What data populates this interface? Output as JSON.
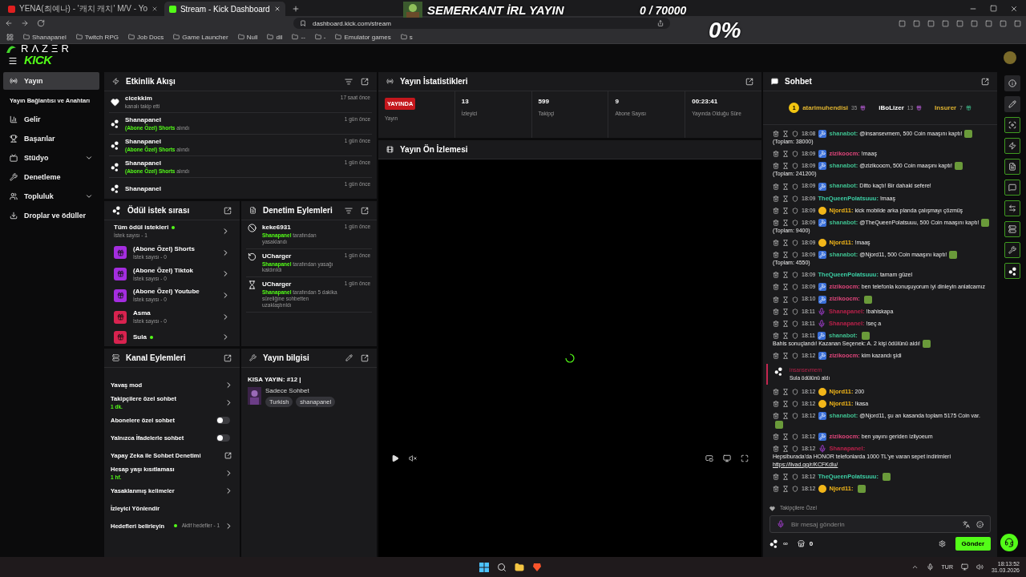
{
  "browser": {
    "tabs": [
      {
        "title": "YENA(최예나) - '캐치 캐치' M/V - Yo",
        "kind": "video",
        "selected": false
      },
      {
        "title": "Stream - Kick Dashboard",
        "kind": "kick",
        "selected": true
      }
    ],
    "url": "dashboard.kick.com/stream",
    "bookmarks": [
      "Shanapanel",
      "Twitch RPG",
      "Job Docs",
      "Game Launcher",
      "Null",
      "dil",
      "--",
      "-",
      "Emulator games",
      "s"
    ]
  },
  "overlay": {
    "title": "SEMERKANT İRL YAYIN",
    "goal": "0 / 70000",
    "percent": "0%",
    "sponsor": "RΛZΞR"
  },
  "header": {
    "logo": "KICK"
  },
  "sidebar": {
    "items": [
      {
        "label": "Yayın",
        "kind": "link",
        "selected": true
      },
      {
        "label": "Yayın Bağlantısı ve Anahtarı",
        "kind": "sub",
        "selected": false
      },
      {
        "label": "Gelir",
        "kind": "link",
        "selected": false
      },
      {
        "label": "Başarılar",
        "kind": "link",
        "selected": false
      },
      {
        "label": "Stüdyo",
        "kind": "group",
        "selected": false
      },
      {
        "label": "Denetleme",
        "kind": "link",
        "selected": false
      },
      {
        "label": "Topluluk",
        "kind": "group",
        "selected": false
      },
      {
        "label": "Droplar ve ödüller",
        "kind": "link",
        "selected": false
      }
    ]
  },
  "activity": {
    "title": "Etkinlik Akışı",
    "items": [
      {
        "kind": "follow",
        "user": "cicekkim",
        "action": "kanalı takip etti",
        "time": "17 saat önce"
      },
      {
        "kind": "redeem",
        "user": "Shanapanel",
        "reward": "(Abone Özel) Shorts",
        "action": "alındı",
        "time": "1 gün önce"
      },
      {
        "kind": "redeem",
        "user": "Shanapanel",
        "reward": "(Abone Özel) Shorts",
        "action": "alındı",
        "time": "1 gün önce"
      },
      {
        "kind": "redeem",
        "user": "Shanapanel",
        "reward": "(Abone Özel) Shorts",
        "action": "alındı",
        "time": "1 gün önce"
      },
      {
        "kind": "redeem",
        "user": "Shanapanel",
        "time": "1 gün önce"
      }
    ]
  },
  "stats": {
    "title": "Yayın İstatistikleri",
    "badge": "YAYINDA",
    "badge_label": "Yayın",
    "items": [
      {
        "value": "13",
        "label": "İzleyici"
      },
      {
        "value": "599",
        "label": "Takipçi"
      },
      {
        "value": "9",
        "label": "Abone Sayısı"
      },
      {
        "value": "00:23:41",
        "label": "Yayında Olduğu Süre"
      }
    ]
  },
  "preview": {
    "title": "Yayın Ön İzlemesi"
  },
  "rewards": {
    "title": "Ödül istek sırası",
    "items": [
      {
        "kind": "all",
        "title": "Tüm ödül istekleri",
        "subtitle": "İstek sayısı - 1",
        "active": true
      },
      {
        "kind": "reward",
        "title": "(Abone Özel) Shorts",
        "subtitle": "İstek sayısı - 0",
        "color": "#a42de0",
        "active": false
      },
      {
        "kind": "reward",
        "title": "(Abone Özel) Tiktok",
        "subtitle": "İstek sayısı - 0",
        "color": "#a42de0",
        "active": false
      },
      {
        "kind": "reward",
        "title": "(Abone Özel) Youtube",
        "subtitle": "İstek sayısı - 0",
        "color": "#a42de0",
        "active": false
      },
      {
        "kind": "reward",
        "title": "Asma",
        "subtitle": "İstek sayısı - 0",
        "color": "#d8234f",
        "active": false
      },
      {
        "kind": "reward",
        "title": "Sula",
        "color": "#d8234f",
        "active": true
      }
    ]
  },
  "moderation": {
    "title": "Denetim Eylemleri",
    "items": [
      {
        "kind": "ban",
        "user": "keke6931",
        "actor": "Shanapanel",
        "text": "tarafından yasaklandı",
        "time": "1 gün önce"
      },
      {
        "kind": "unban",
        "user": "UCharger",
        "actor": "Shanapanel",
        "text": "tarafından yasağı kaldırıldı",
        "time": "1 gün önce"
      },
      {
        "kind": "timeout",
        "user": "UCharger",
        "actor": "Shanapanel",
        "text": "tarafından 5 dakika süreliğine sohbetten uzaklaştırıldı",
        "time": "1 gün önce"
      }
    ]
  },
  "channel_actions": {
    "title": "Kanal Eylemleri",
    "items": [
      {
        "kind": "link",
        "label": "Yavaş mod"
      },
      {
        "kind": "link",
        "label": "Takipçilere özel sohbet",
        "value": "1 dk."
      },
      {
        "kind": "toggle",
        "label": "Abonelere özel sohbet",
        "on": false
      },
      {
        "kind": "toggle",
        "label": "Yalnızca İfadelerle sohbet",
        "on": false
      },
      {
        "kind": "external",
        "label": "Yapay Zeka ile Sohbet Denetimi"
      },
      {
        "kind": "link",
        "label": "Hesap yaşı kısıtlaması",
        "value": "1 hf."
      },
      {
        "kind": "link",
        "label": "Yasaklanmış kelimeler"
      },
      {
        "kind": "plain",
        "label": "İzleyici Yönlendir"
      },
      {
        "kind": "goal",
        "label": "Hedefleri belirleyin",
        "note": "Aktif hedefler - 1"
      }
    ]
  },
  "stream_info": {
    "title": "Yayın bilgisi",
    "stream_title": "KISA YAYIN: #12 |",
    "category": "Sadece Sohbet",
    "tags": [
      "Turkish",
      "shanapanel"
    ]
  },
  "chat": {
    "title": "Sohbet",
    "top": [
      {
        "name": "atarimuhendisi",
        "count": "35",
        "rank": "1"
      },
      {
        "name": "iBoLizer",
        "count": "13"
      },
      {
        "name": "Insurer",
        "count": "7"
      }
    ],
    "messages": [
      {
        "kind": "bot",
        "time": "18:08",
        "user": "shanabot:",
        "color": "#3fbf8f",
        "parts": [
          {
            "kind": "text",
            "text": "@insansevmem, 500 Coin maaşını kaptı!"
          },
          {
            "kind": "emote"
          },
          {
            "kind": "text",
            "text": "(Toplam: 38000)"
          }
        ]
      },
      {
        "kind": "bot",
        "time": "18:09",
        "user": "zizikoocm:",
        "color": "#e0457b",
        "parts": [
          {
            "kind": "text",
            "text": "!maaş"
          }
        ]
      },
      {
        "kind": "bot",
        "time": "18:09",
        "user": "shanabot:",
        "color": "#3fbf8f",
        "parts": [
          {
            "kind": "text",
            "text": "@zizikoocm, 500 Coin maaşını kaptı!"
          },
          {
            "kind": "emote"
          },
          {
            "kind": "text",
            "text": "(Toplam: 241200)"
          }
        ]
      },
      {
        "kind": "bot",
        "time": "18:09",
        "user": "shanabot:",
        "color": "#3fbf8f",
        "parts": [
          {
            "kind": "text",
            "text": "Ditto kaçtı! Bir dahaki sefere!"
          }
        ]
      },
      {
        "kind": "plain",
        "time": "18:09",
        "user": "TheQueenPolatsuuu:",
        "color": "#3ccfa5",
        "parts": [
          {
            "kind": "text",
            "text": "!maaş"
          }
        ]
      },
      {
        "kind": "coin",
        "time": "18:09",
        "user": "Njord11:",
        "color": "#f2b619",
        "parts": [
          {
            "kind": "text",
            "text": "kick mobilde arka planda çalışmayı çözmüş"
          }
        ]
      },
      {
        "kind": "bot",
        "time": "18:09",
        "user": "shanabot:",
        "color": "#3fbf8f",
        "parts": [
          {
            "kind": "text",
            "text": "@TheQueenPolatsuuu, 500 Coin maaşını kaptı!"
          },
          {
            "kind": "emote"
          },
          {
            "kind": "text",
            "text": "(Toplam: 9400)"
          }
        ]
      },
      {
        "kind": "coin",
        "time": "18:09",
        "user": "Njord11:",
        "color": "#f2b619",
        "parts": [
          {
            "kind": "text",
            "text": "!maaş"
          }
        ]
      },
      {
        "kind": "bot",
        "time": "18:09",
        "user": "shanabot:",
        "color": "#3fbf8f",
        "parts": [
          {
            "kind": "text",
            "text": "@Njord11, 500 Coin maaşını kaptı!"
          },
          {
            "kind": "emote"
          },
          {
            "kind": "text",
            "text": "(Toplam: 4550)"
          }
        ]
      },
      {
        "kind": "plain",
        "time": "18:09",
        "user": "TheQueenPolatsuuu:",
        "color": "#3ccfa5",
        "parts": [
          {
            "kind": "text",
            "text": "tamam güzel"
          }
        ]
      },
      {
        "kind": "bot",
        "time": "18:09",
        "user": "zizikoocm:",
        "color": "#e0457b",
        "parts": [
          {
            "kind": "text",
            "text": "ben telefonla konuşuyorum iyi dinleyin anlatcamız"
          }
        ]
      },
      {
        "kind": "bot",
        "time": "18:10",
        "user": "zizikoocm:",
        "color": "#e0457b",
        "parts": [
          {
            "kind": "emote"
          }
        ]
      },
      {
        "kind": "sub",
        "time": "18:11",
        "user": "Shanapanel:",
        "color": "#b8214a",
        "parts": [
          {
            "kind": "text",
            "text": "!bahiskapa"
          }
        ]
      },
      {
        "kind": "sub",
        "time": "18:11",
        "user": "Shanapanel:",
        "color": "#b8214a",
        "parts": [
          {
            "kind": "text",
            "text": "!seç a"
          }
        ]
      },
      {
        "kind": "bot",
        "time": "18:11",
        "user": "shanabot:",
        "color": "#3fbf8f",
        "parts": [
          {
            "kind": "emote"
          },
          {
            "kind": "text",
            "text": "Bahis sonuçlandı! Kazanan Seçenek: A. 2 kişi ödülünü aldı!"
          },
          {
            "kind": "emote"
          }
        ]
      },
      {
        "kind": "bot",
        "time": "18:12",
        "user": "zizikoocm:",
        "color": "#e0457b",
        "parts": [
          {
            "kind": "text",
            "text": "kim kazandı şidi"
          }
        ]
      },
      {
        "kind": "reward",
        "user": "insansevmem",
        "text": "Sula ödülünü aldı"
      },
      {
        "kind": "coin",
        "time": "18:12",
        "user": "Njord11:",
        "color": "#f2b619",
        "parts": [
          {
            "kind": "text",
            "text": "200"
          }
        ]
      },
      {
        "kind": "coin",
        "time": "18:12",
        "user": "Njord11:",
        "color": "#f2b619",
        "parts": [
          {
            "kind": "text",
            "text": "!kasa"
          }
        ]
      },
      {
        "kind": "bot",
        "time": "18:12",
        "user": "shanabot:",
        "color": "#3fbf8f",
        "parts": [
          {
            "kind": "text",
            "text": "@Njord11, şu an kasanda toplam 5175 Coin var."
          },
          {
            "kind": "emote"
          }
        ]
      },
      {
        "kind": "bot",
        "time": "18:12",
        "user": "zizikoocm:",
        "color": "#e0457b",
        "parts": [
          {
            "kind": "text",
            "text": "ben yayını geriden izliyoeum"
          }
        ]
      },
      {
        "kind": "sub",
        "time": "18:12",
        "user": "Shanapanel:",
        "color": "#b8214a",
        "parts": [
          {
            "kind": "text",
            "text": "Hepsiburada'da HONOR telefonlarda 1000 TL'ye varan sepet indirimleri"
          },
          {
            "kind": "link",
            "text": "https://livad.gg/r/KCFKdlu/"
          }
        ]
      },
      {
        "kind": "plain",
        "time": "18:12",
        "user": "TheQueenPolatsuuu:",
        "color": "#3ccfa5",
        "parts": [
          {
            "kind": "emote"
          }
        ]
      },
      {
        "kind": "coin",
        "time": "18:12",
        "user": "Njord11:",
        "color": "#f2b619",
        "parts": [
          {
            "kind": "emote"
          }
        ]
      }
    ],
    "mode": "Takipçilere Özel",
    "placeholder": "Bir mesaj gönderin",
    "limit": "∞",
    "points": "0",
    "send": "Gönder"
  },
  "taskbar": {
    "language": "TUR",
    "time": "18:13:52",
    "date": "31.03.2026"
  }
}
